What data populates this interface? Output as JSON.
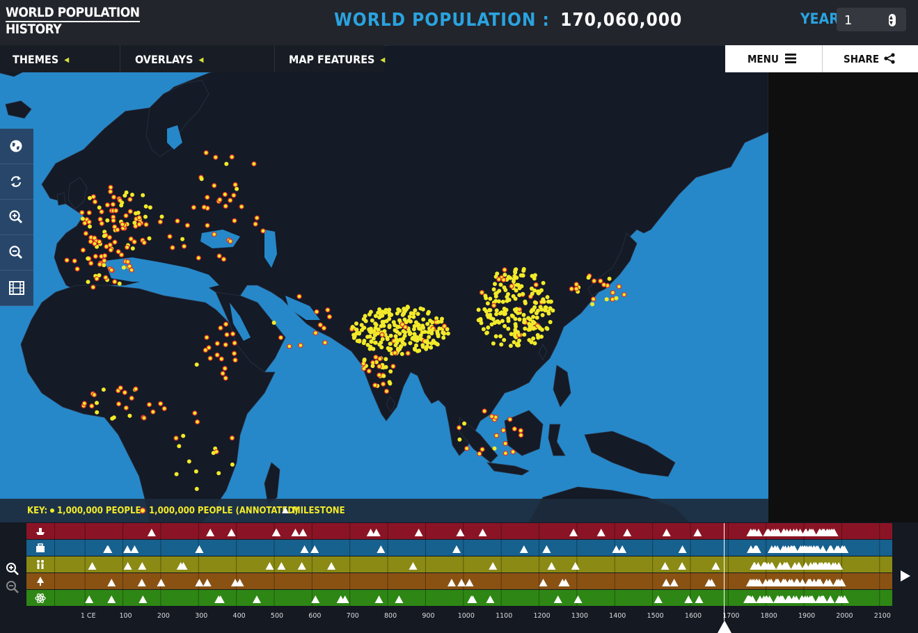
{
  "header": {
    "logo_line1": "WORLD POPULATION",
    "logo_line2": "HISTORY",
    "title_label": "WORLD POPULATION :",
    "population_value": "170,060,000",
    "year_label": "YEAR:",
    "year_value": "1"
  },
  "tabs": [
    {
      "label": "THEMES"
    },
    {
      "label": "OVERLAYS"
    },
    {
      "label": "MAP FEATURES"
    }
  ],
  "top_buttons": {
    "menu_label": "MENU",
    "share_label": "SHARE"
  },
  "left_tools": [
    "globe-icon",
    "rotate-icon",
    "zoom-in-icon",
    "zoom-out-icon",
    "film-icon"
  ],
  "key": {
    "prefix": "KEY:",
    "item1": "1,000,000 PEOPLE",
    "item2": "1,000,000 PEOPLE (ANNOTATED)",
    "item3": "MILESTONE"
  },
  "timeline": {
    "tracks": [
      {
        "icon": "ship-icon",
        "color": "#8a1425"
      },
      {
        "icon": "briefcase-icon",
        "color": "#17618f"
      },
      {
        "icon": "people-icon",
        "color": "#8a8a14"
      },
      {
        "icon": "tree-icon",
        "color": "#8a5212"
      },
      {
        "icon": "atom-icon",
        "color": "#2e8714"
      }
    ],
    "ticks": [
      "1 CE",
      "100",
      "200",
      "300",
      "400",
      "500",
      "600",
      "700",
      "800",
      "900",
      "1000",
      "1100",
      "1200",
      "1300",
      "1400",
      "1500",
      "1600",
      "1700",
      "1800",
      "1900",
      "2000",
      "2100"
    ],
    "current_year": 1
  },
  "colors": {
    "ocean": "#2688c9",
    "land": "#141a26",
    "dot": "#f2ea2a",
    "accent_blue": "#2aa3e0",
    "accent_yellow": "#d6e03a"
  }
}
